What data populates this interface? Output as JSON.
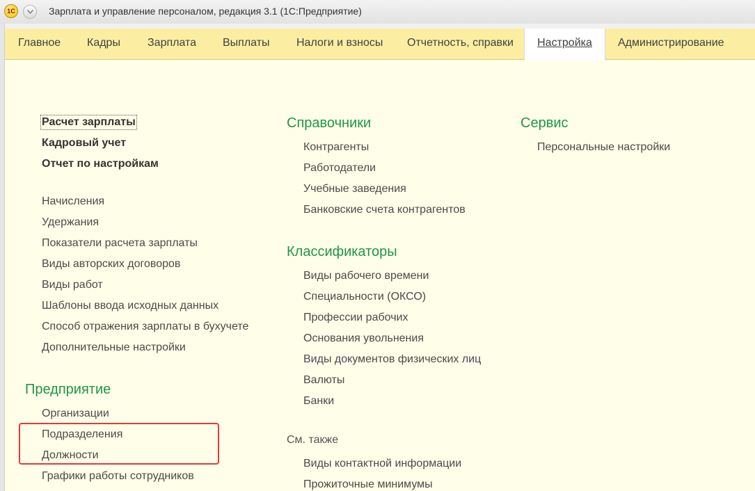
{
  "window": {
    "title": "Зарплата и управление персоналом, редакция 3.1  (1С:Предприятие)",
    "logo_text": "1С"
  },
  "tabs": [
    {
      "label": "Главное"
    },
    {
      "label": "Кадры"
    },
    {
      "label": "Зарплата"
    },
    {
      "label": "Выплаты"
    },
    {
      "label": "Налоги и взносы"
    },
    {
      "label": "Отчетность, справки"
    },
    {
      "label": "Настройка",
      "active": true
    },
    {
      "label": "Администрирование"
    }
  ],
  "left": {
    "bold_items": [
      "Расчет зарплаты",
      "Кадровый учет",
      "Отчет по настройкам"
    ],
    "items": [
      "Начисления",
      "Удержания",
      "Показатели расчета зарплаты",
      "Виды авторских договоров",
      "Виды работ",
      "Шаблоны ввода исходных данных",
      "Способ отражения зарплаты в бухучете",
      "Дополнительные настройки"
    ],
    "enterprise": {
      "heading": "Предприятие",
      "items": [
        "Организации",
        "Подразделения",
        "Должности",
        "Графики работы сотрудников"
      ]
    }
  },
  "middle": {
    "directories": {
      "heading": "Справочники",
      "items": [
        "Контрагенты",
        "Работодатели",
        "Учебные заведения",
        "Банковские счета контрагентов"
      ]
    },
    "classifiers": {
      "heading": "Классификаторы",
      "items": [
        "Виды рабочего времени",
        "Специальности (ОКСО)",
        "Профессии рабочих",
        "Основания увольнения",
        "Виды документов физических лиц",
        "Валюты",
        "Банки"
      ]
    },
    "see_also": {
      "heading": "См. также",
      "items": [
        "Виды контактной информации",
        "Прожиточные минимумы"
      ]
    }
  },
  "right": {
    "service": {
      "heading": "Сервис",
      "items": [
        "Персональные настройки"
      ]
    }
  },
  "colors": {
    "accent_green": "#1f9548",
    "tabs_background": "#fbeea2",
    "page_background": "#fffee8",
    "highlight_box": "#e03a3a"
  }
}
